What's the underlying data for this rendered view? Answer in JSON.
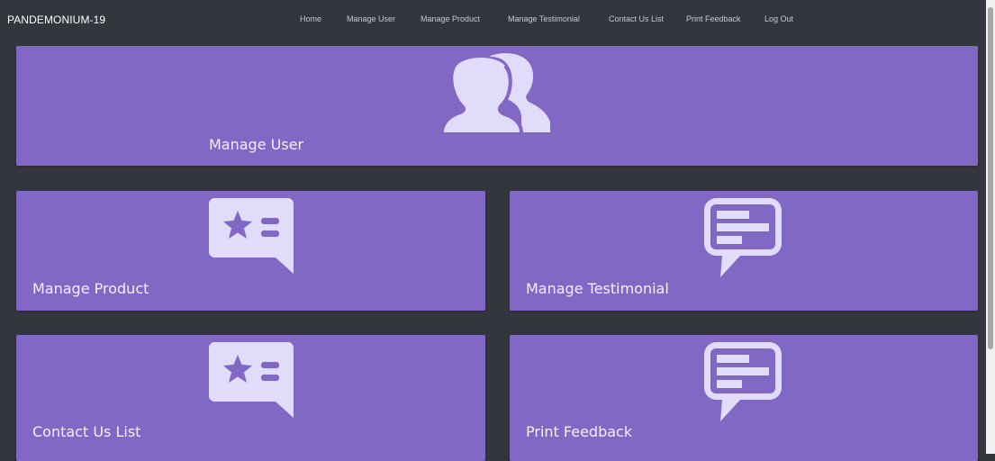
{
  "brand": "PANDEMONIUM-19",
  "nav": {
    "home": "Home",
    "manage_user": "Manage User",
    "manage_product": "Manage Product",
    "manage_testimonial": "Manage Testimonial",
    "contact_us_list": "Contact Us List",
    "print_feedback": "Print Feedback",
    "log_out": "Log Out"
  },
  "cards": {
    "manage_user": {
      "label": "Manage User",
      "icon": "users-icon"
    },
    "manage_product": {
      "label": "Manage Product",
      "icon": "id-card-star-icon"
    },
    "manage_testimonial": {
      "label": "Manage Testimonial",
      "icon": "comment-lines-icon"
    },
    "contact_us_list": {
      "label": "Contact Us List",
      "icon": "id-card-star-icon"
    },
    "print_feedback": {
      "label": "Print Feedback",
      "icon": "comment-lines-icon"
    }
  },
  "colors": {
    "background": "#33363d",
    "card": "#8068c4",
    "icon": "#e2dcfb",
    "label": "#f3efff"
  }
}
